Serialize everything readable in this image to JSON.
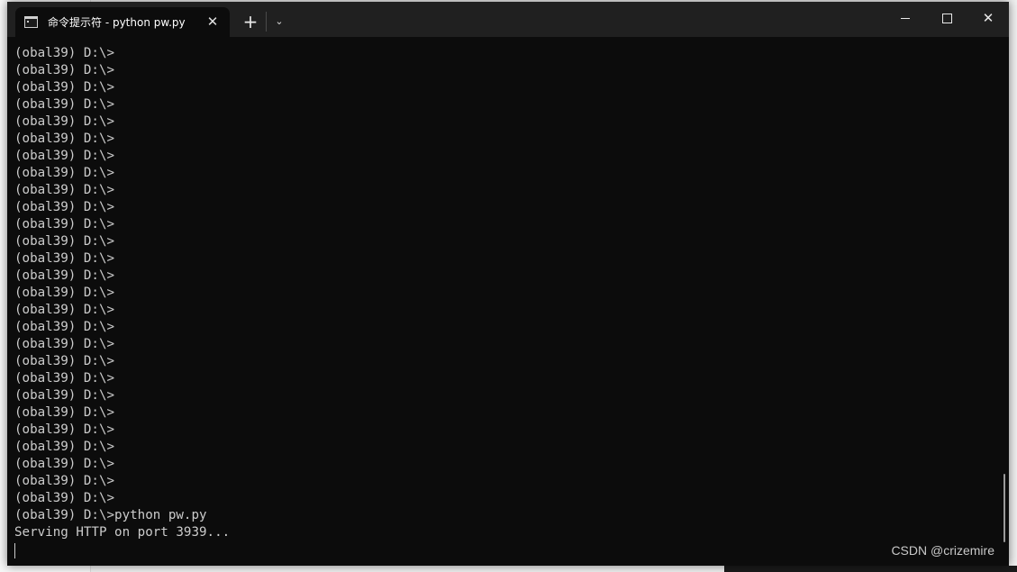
{
  "window": {
    "tab_title": "命令提示符 - python  pw.py",
    "tab_close": "✕",
    "new_tab": "+",
    "dropdown": "⌄",
    "close_glyph": "✕"
  },
  "terminal": {
    "lines": [
      "(obal39) D:\\>",
      "(obal39) D:\\>",
      "(obal39) D:\\>",
      "(obal39) D:\\>",
      "(obal39) D:\\>",
      "(obal39) D:\\>",
      "(obal39) D:\\>",
      "(obal39) D:\\>",
      "(obal39) D:\\>",
      "(obal39) D:\\>",
      "(obal39) D:\\>",
      "(obal39) D:\\>",
      "(obal39) D:\\>",
      "(obal39) D:\\>",
      "(obal39) D:\\>",
      "(obal39) D:\\>",
      "(obal39) D:\\>",
      "(obal39) D:\\>",
      "(obal39) D:\\>",
      "(obal39) D:\\>",
      "(obal39) D:\\>",
      "(obal39) D:\\>",
      "(obal39) D:\\>",
      "(obal39) D:\\>",
      "(obal39) D:\\>",
      "(obal39) D:\\>",
      "(obal39) D:\\>",
      "(obal39) D:\\>python pw.py",
      "Serving HTTP on port 3939..."
    ]
  },
  "watermark": "CSDN @crizemire",
  "colors": {
    "terminal_bg": "#0c0c0c",
    "terminal_fg": "#cccccc",
    "titlebar_bg": "#202020"
  }
}
